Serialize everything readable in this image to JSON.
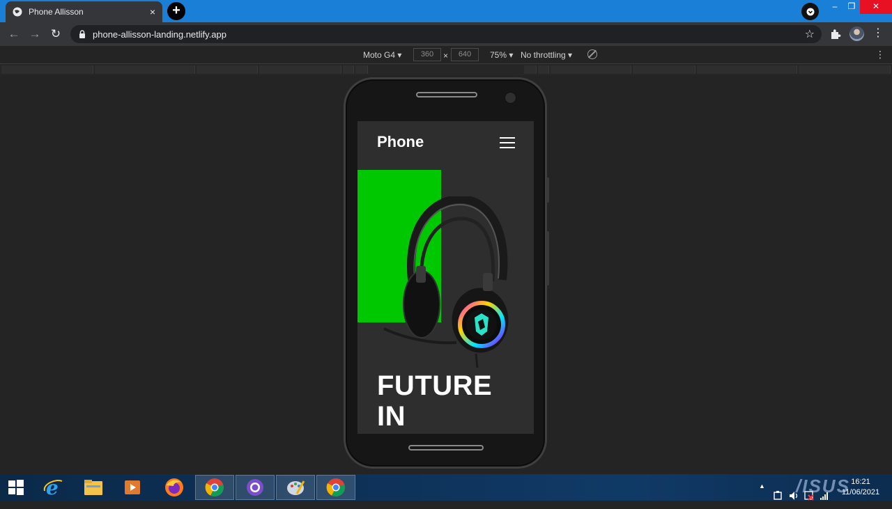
{
  "browser": {
    "tab_title": "Phone Allisson",
    "tab_close": "×",
    "new_tab": "+",
    "url": "phone-allisson-landing.netlify.app",
    "win_min": "–",
    "win_restore": "❐",
    "win_close": "✕"
  },
  "devtools": {
    "device": "Moto G4 ▾",
    "width": "360",
    "height": "640",
    "times": "×",
    "zoom": "75% ▾",
    "throttling": "No throttling ▾"
  },
  "page": {
    "brand": "Phone",
    "hero_line1": "FUTURE",
    "hero_line2": "IN",
    "accent_color": "#00c800"
  },
  "taskbar": {
    "time": "16:21",
    "date": "11/06/2021",
    "logo": "/ISUS"
  }
}
